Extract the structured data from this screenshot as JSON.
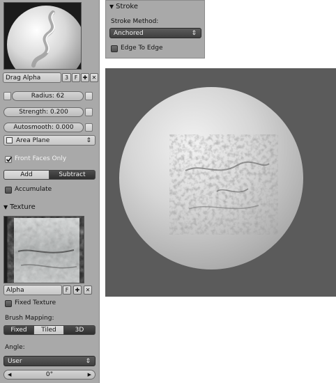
{
  "brush": {
    "name": "Drag Alpha",
    "users": "3",
    "fake_user": "F"
  },
  "radius": {
    "label": "Radius: 62"
  },
  "strength": {
    "label": "Strength: 0.200"
  },
  "autosmooth": {
    "label": "Autosmooth: 0.000"
  },
  "sculpt_plane": {
    "value": "Area Plane"
  },
  "front_faces_only": {
    "label": "Front Faces Only",
    "checked": true
  },
  "direction": {
    "options": [
      "Add",
      "Subtract"
    ],
    "active": "Subtract"
  },
  "accumulate": {
    "label": "Accumulate",
    "checked": false
  },
  "texture": {
    "header": "Texture",
    "name": "Alpha",
    "fake_user": "F",
    "fixed_texture_label": "Fixed Texture",
    "fixed_texture_checked": false,
    "brush_mapping_label": "Brush Mapping:",
    "mapping_options": [
      "Fixed",
      "Tiled",
      "3D"
    ],
    "mapping_active": "Tiled",
    "angle_label": "Angle:",
    "angle_mode": "User",
    "angle_value": "0°"
  },
  "stroke": {
    "header": "Stroke",
    "method_label": "Stroke Method:",
    "method_value": "Anchored",
    "edge_to_edge_label": "Edge To Edge",
    "edge_to_edge_checked": false
  },
  "colors": {
    "panel_bg": "#a9a9a9",
    "viewport_bg": "#5b5b5b",
    "active_button": "#3a3a3a"
  }
}
